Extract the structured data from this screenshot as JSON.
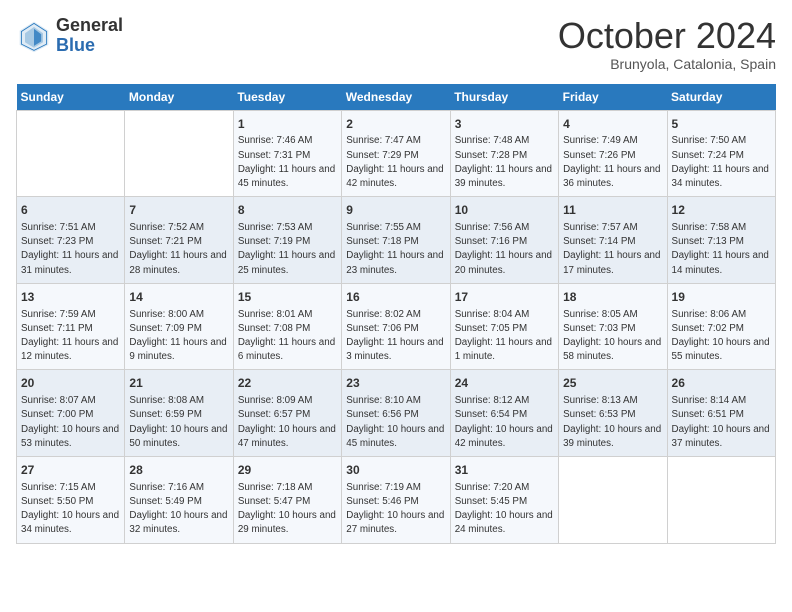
{
  "logo": {
    "line1": "General",
    "line2": "Blue"
  },
  "title": "October 2024",
  "subtitle": "Brunyola, Catalonia, Spain",
  "weekdays": [
    "Sunday",
    "Monday",
    "Tuesday",
    "Wednesday",
    "Thursday",
    "Friday",
    "Saturday"
  ],
  "rows": [
    [
      {
        "day": "",
        "info": ""
      },
      {
        "day": "",
        "info": ""
      },
      {
        "day": "1",
        "info": "Sunrise: 7:46 AM\nSunset: 7:31 PM\nDaylight: 11 hours and 45 minutes."
      },
      {
        "day": "2",
        "info": "Sunrise: 7:47 AM\nSunset: 7:29 PM\nDaylight: 11 hours and 42 minutes."
      },
      {
        "day": "3",
        "info": "Sunrise: 7:48 AM\nSunset: 7:28 PM\nDaylight: 11 hours and 39 minutes."
      },
      {
        "day": "4",
        "info": "Sunrise: 7:49 AM\nSunset: 7:26 PM\nDaylight: 11 hours and 36 minutes."
      },
      {
        "day": "5",
        "info": "Sunrise: 7:50 AM\nSunset: 7:24 PM\nDaylight: 11 hours and 34 minutes."
      }
    ],
    [
      {
        "day": "6",
        "info": "Sunrise: 7:51 AM\nSunset: 7:23 PM\nDaylight: 11 hours and 31 minutes."
      },
      {
        "day": "7",
        "info": "Sunrise: 7:52 AM\nSunset: 7:21 PM\nDaylight: 11 hours and 28 minutes."
      },
      {
        "day": "8",
        "info": "Sunrise: 7:53 AM\nSunset: 7:19 PM\nDaylight: 11 hours and 25 minutes."
      },
      {
        "day": "9",
        "info": "Sunrise: 7:55 AM\nSunset: 7:18 PM\nDaylight: 11 hours and 23 minutes."
      },
      {
        "day": "10",
        "info": "Sunrise: 7:56 AM\nSunset: 7:16 PM\nDaylight: 11 hours and 20 minutes."
      },
      {
        "day": "11",
        "info": "Sunrise: 7:57 AM\nSunset: 7:14 PM\nDaylight: 11 hours and 17 minutes."
      },
      {
        "day": "12",
        "info": "Sunrise: 7:58 AM\nSunset: 7:13 PM\nDaylight: 11 hours and 14 minutes."
      }
    ],
    [
      {
        "day": "13",
        "info": "Sunrise: 7:59 AM\nSunset: 7:11 PM\nDaylight: 11 hours and 12 minutes."
      },
      {
        "day": "14",
        "info": "Sunrise: 8:00 AM\nSunset: 7:09 PM\nDaylight: 11 hours and 9 minutes."
      },
      {
        "day": "15",
        "info": "Sunrise: 8:01 AM\nSunset: 7:08 PM\nDaylight: 11 hours and 6 minutes."
      },
      {
        "day": "16",
        "info": "Sunrise: 8:02 AM\nSunset: 7:06 PM\nDaylight: 11 hours and 3 minutes."
      },
      {
        "day": "17",
        "info": "Sunrise: 8:04 AM\nSunset: 7:05 PM\nDaylight: 11 hours and 1 minute."
      },
      {
        "day": "18",
        "info": "Sunrise: 8:05 AM\nSunset: 7:03 PM\nDaylight: 10 hours and 58 minutes."
      },
      {
        "day": "19",
        "info": "Sunrise: 8:06 AM\nSunset: 7:02 PM\nDaylight: 10 hours and 55 minutes."
      }
    ],
    [
      {
        "day": "20",
        "info": "Sunrise: 8:07 AM\nSunset: 7:00 PM\nDaylight: 10 hours and 53 minutes."
      },
      {
        "day": "21",
        "info": "Sunrise: 8:08 AM\nSunset: 6:59 PM\nDaylight: 10 hours and 50 minutes."
      },
      {
        "day": "22",
        "info": "Sunrise: 8:09 AM\nSunset: 6:57 PM\nDaylight: 10 hours and 47 minutes."
      },
      {
        "day": "23",
        "info": "Sunrise: 8:10 AM\nSunset: 6:56 PM\nDaylight: 10 hours and 45 minutes."
      },
      {
        "day": "24",
        "info": "Sunrise: 8:12 AM\nSunset: 6:54 PM\nDaylight: 10 hours and 42 minutes."
      },
      {
        "day": "25",
        "info": "Sunrise: 8:13 AM\nSunset: 6:53 PM\nDaylight: 10 hours and 39 minutes."
      },
      {
        "day": "26",
        "info": "Sunrise: 8:14 AM\nSunset: 6:51 PM\nDaylight: 10 hours and 37 minutes."
      }
    ],
    [
      {
        "day": "27",
        "info": "Sunrise: 7:15 AM\nSunset: 5:50 PM\nDaylight: 10 hours and 34 minutes."
      },
      {
        "day": "28",
        "info": "Sunrise: 7:16 AM\nSunset: 5:49 PM\nDaylight: 10 hours and 32 minutes."
      },
      {
        "day": "29",
        "info": "Sunrise: 7:18 AM\nSunset: 5:47 PM\nDaylight: 10 hours and 29 minutes."
      },
      {
        "day": "30",
        "info": "Sunrise: 7:19 AM\nSunset: 5:46 PM\nDaylight: 10 hours and 27 minutes."
      },
      {
        "day": "31",
        "info": "Sunrise: 7:20 AM\nSunset: 5:45 PM\nDaylight: 10 hours and 24 minutes."
      },
      {
        "day": "",
        "info": ""
      },
      {
        "day": "",
        "info": ""
      }
    ]
  ]
}
